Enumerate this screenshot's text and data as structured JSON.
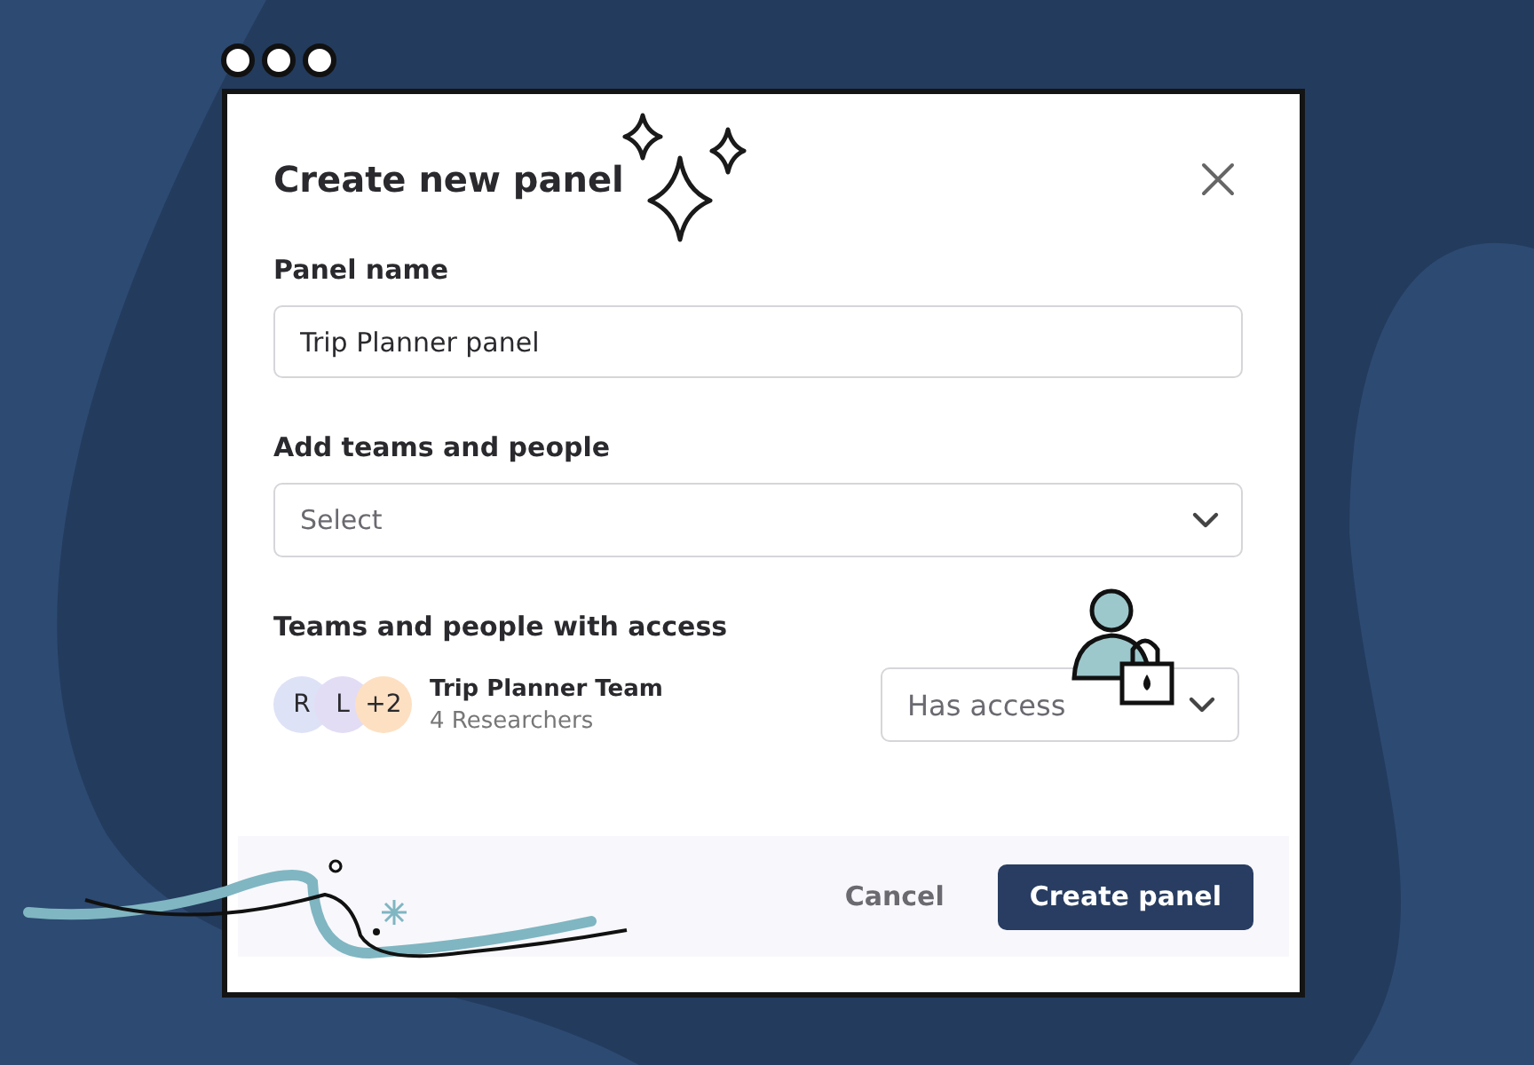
{
  "dialog": {
    "title": "Create new panel",
    "fields": [
      {
        "kind": "text",
        "label": "Panel name",
        "value": "Trip Planner panel"
      },
      {
        "kind": "select",
        "label": "Add teams and people",
        "placeholder": "Select"
      }
    ],
    "access": {
      "label": "Teams and people with access",
      "teams": [
        {
          "name": "Trip Planner Team",
          "subtitle": "4 Researchers",
          "permission": "Has access",
          "avatars": [
            {
              "text": "R",
              "color": "#dde2f6"
            },
            {
              "text": "L",
              "color": "#e3dcf5"
            },
            {
              "text": "+2",
              "color": "#fde0c2"
            }
          ]
        }
      ]
    },
    "buttons": [
      {
        "kind": "secondary",
        "label": "Cancel"
      },
      {
        "kind": "primary",
        "label": "Create panel"
      }
    ]
  }
}
